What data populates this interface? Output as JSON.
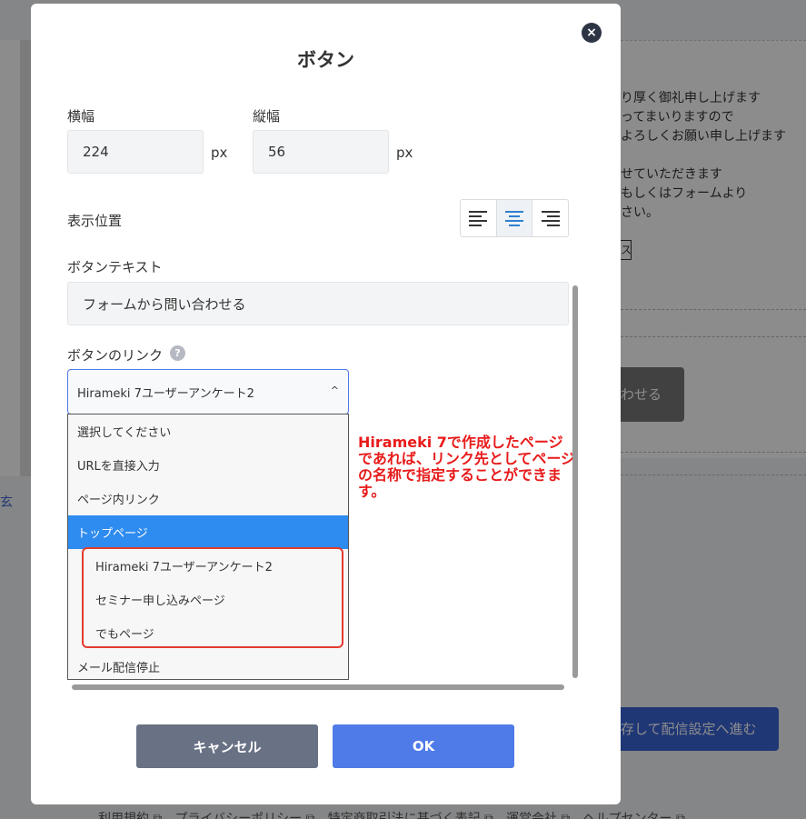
{
  "background": {
    "right_text_lines": [
      "り厚く御礼申し上げます",
      "ってまいりますので",
      "よろしくお願い申し上げます",
      "",
      "せていただきます",
      "もしくはフォームより",
      "さい。"
    ],
    "box_char": "ス",
    "grey_button": "わせる",
    "blue_button": "存して配信設定へ進む",
    "left_link": "玄",
    "footer": "利用規約 ⧉　プライバシーポリシー ⧉　特定商取引法に基づく表記 ⧉　運営会社 ⧉　ヘルプセンター ⧉"
  },
  "modal": {
    "title": "ボタン",
    "close_icon": "×",
    "width_label": "横幅",
    "width_value": "224",
    "width_unit": "px",
    "height_label": "縦幅",
    "height_value": "56",
    "height_unit": "px",
    "position_label": "表示位置",
    "alignment_selected": "center",
    "button_text_label": "ボタンテキスト",
    "button_text_value": "フォームから問い合わせる",
    "link_label": "ボタンのリンク",
    "help_icon": "?",
    "link_selected": "Hirameki 7ユーザーアンケート2",
    "link_chevron": "^",
    "dropdown_items": [
      "選択してください",
      "URLを直接入力",
      "ページ内リンク",
      "トップページ",
      "Hirameki 7ユーザーアンケート2",
      "セミナー申し込みページ",
      "でもページ",
      "メール配信停止"
    ],
    "annotation": "Hirameki 7で作成したページであれば、リンク先としてページの名称で指定することができます。",
    "cancel_button": "キャンセル",
    "ok_button": "OK"
  },
  "colors": {
    "primary": "#4f7be8",
    "selected_item": "#2e8bf0",
    "annotation": "#e81b1b",
    "cancel": "#697185"
  }
}
